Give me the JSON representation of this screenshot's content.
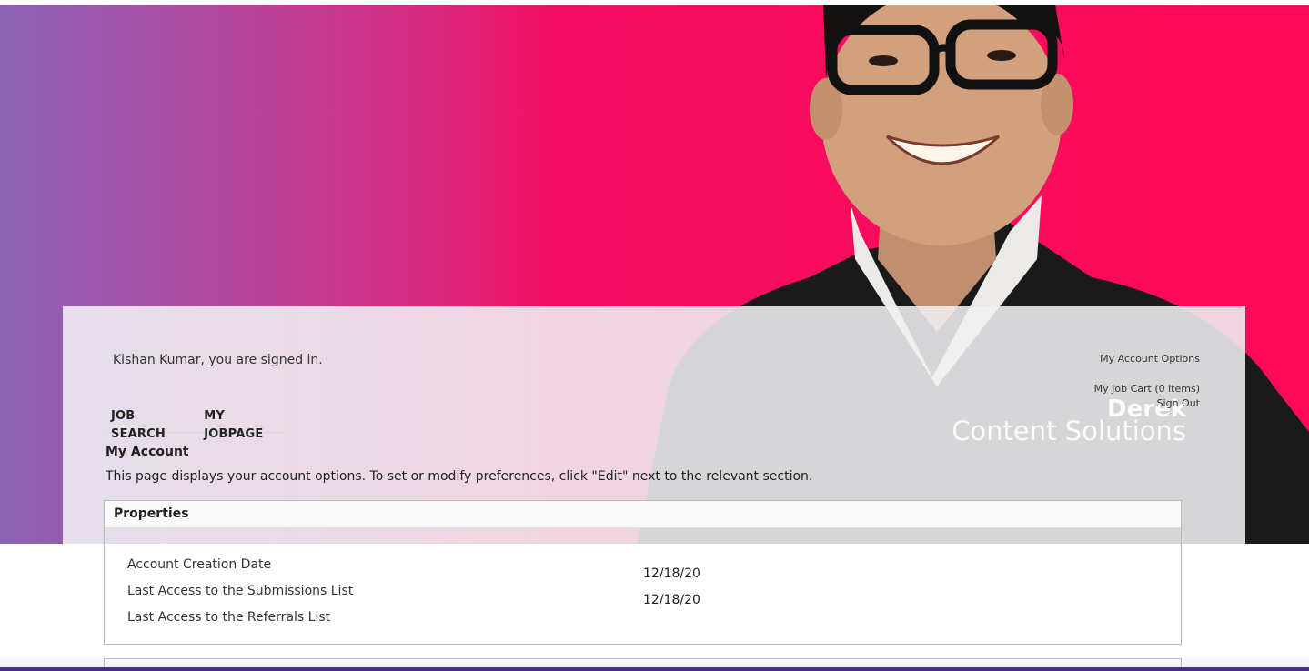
{
  "header": {
    "signed_in_text": "Kishan Kumar, you are signed in.",
    "overlay_name": "Derek",
    "overlay_subtitle": "Content Solutions"
  },
  "account_links": {
    "options": "My Account Options",
    "job_cart": "My Job Cart (0 items)",
    "sign_out": "Sign Out"
  },
  "nav": {
    "job_search": "JOB SEARCH",
    "my_jobpage": "MY JOBPAGE"
  },
  "main": {
    "title": "My Account",
    "description": "This page displays your account options. To set or modify preferences, click \"Edit\" next to the relevant section."
  },
  "properties": {
    "header": "Properties",
    "rows": [
      {
        "label": "Account Creation Date",
        "value": "12/18/20"
      },
      {
        "label": "Last Access to the Submissions List",
        "value": "12/18/20"
      },
      {
        "label": "Last Access to the Referrals List",
        "value": ""
      }
    ]
  },
  "colors": {
    "gradient_start": "#8c63b6",
    "gradient_end": "#ff0a58",
    "text": "#222222"
  }
}
